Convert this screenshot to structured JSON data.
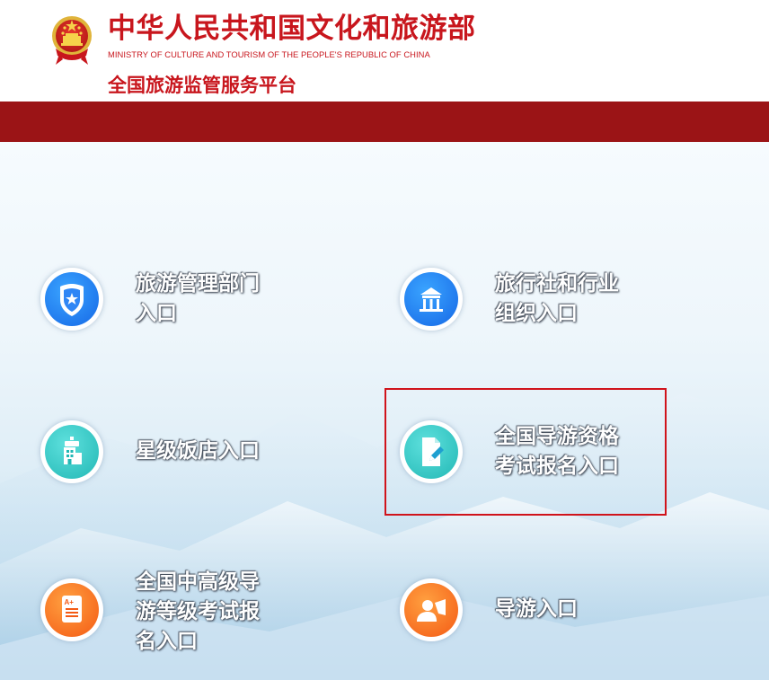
{
  "header": {
    "ministry_cn": "中华人民共和国文化和旅游部",
    "ministry_en": "MINISTRY OF CULTURE AND TOURISM OF THE PEOPLE'S REPUBLIC OF CHINA",
    "platform": "全国旅游监管服务平台"
  },
  "entries": [
    {
      "line1": "旅游管理部门",
      "line2": "入口",
      "icon": "shield-star-icon"
    },
    {
      "line1": "旅行社和行业",
      "line2": "组织入口",
      "icon": "building-icon"
    },
    {
      "line1": "星级饭店入口",
      "icon": "hotel-icon"
    },
    {
      "line1": "全国导游资格",
      "line2": "考试报名入口",
      "icon": "document-edit-icon"
    },
    {
      "line1": "全国中高级导",
      "line2": "游等级考试报",
      "line3": "名入口",
      "icon": "grade-document-icon"
    },
    {
      "line1": "导游入口",
      "icon": "guide-person-icon"
    }
  ],
  "colors": {
    "brand_red": "#c8161d",
    "bar_red": "#9b1416",
    "highlight": "#d0131b"
  }
}
